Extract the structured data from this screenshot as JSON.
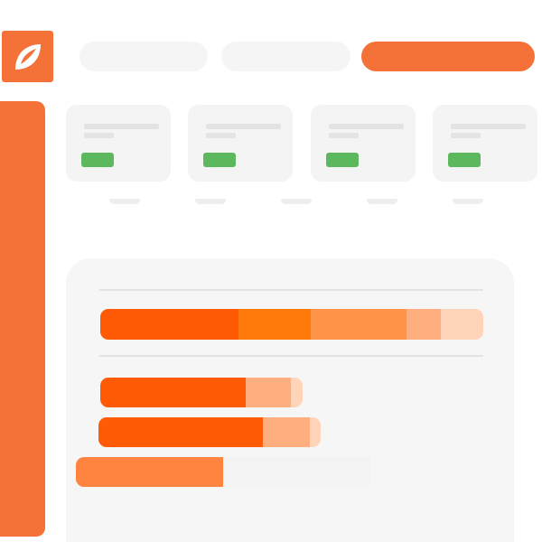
{
  "colors": {
    "brand": "#f47137",
    "card_bg": "#f4f4f4",
    "pill_bg": "#f5f5f5",
    "panel_bg": "#f6f6f6",
    "success": "#5cb85c"
  },
  "icons": {
    "logo": "leaf-icon"
  },
  "header": {
    "pills": [
      {
        "state": "inactive"
      },
      {
        "state": "inactive"
      },
      {
        "state": "active"
      }
    ]
  },
  "cards": [
    {
      "status": "success"
    },
    {
      "status": "success"
    },
    {
      "status": "success"
    },
    {
      "status": "success"
    }
  ],
  "breakdown": {
    "stacked_bar": {
      "segments": [
        {
          "share": 0.36,
          "color": "#ff5a05"
        },
        {
          "share": 0.19,
          "color": "#ff7a0a"
        },
        {
          "share": 0.25,
          "color": "#ff9448"
        },
        {
          "share": 0.09,
          "color": "#ffae80"
        },
        {
          "share": 0.11,
          "color": "#ffd4b8"
        }
      ]
    },
    "bars": [
      {
        "segments": [
          {
            "share": 0.72,
            "color": "#ff5a05"
          },
          {
            "share": 0.22,
            "color": "#ffae80"
          },
          {
            "share": 0.06,
            "color": "#ffd4b8"
          }
        ]
      },
      {
        "segments": [
          {
            "share": 0.74,
            "color": "#ff5a05"
          },
          {
            "share": 0.21,
            "color": "#ffae80"
          },
          {
            "share": 0.05,
            "color": "#ffd4b8"
          }
        ]
      },
      {
        "segments": [
          {
            "share": 0.5,
            "color": "#ff8440"
          },
          {
            "share": 0.5,
            "color": "#f3f3f3"
          }
        ]
      }
    ]
  }
}
